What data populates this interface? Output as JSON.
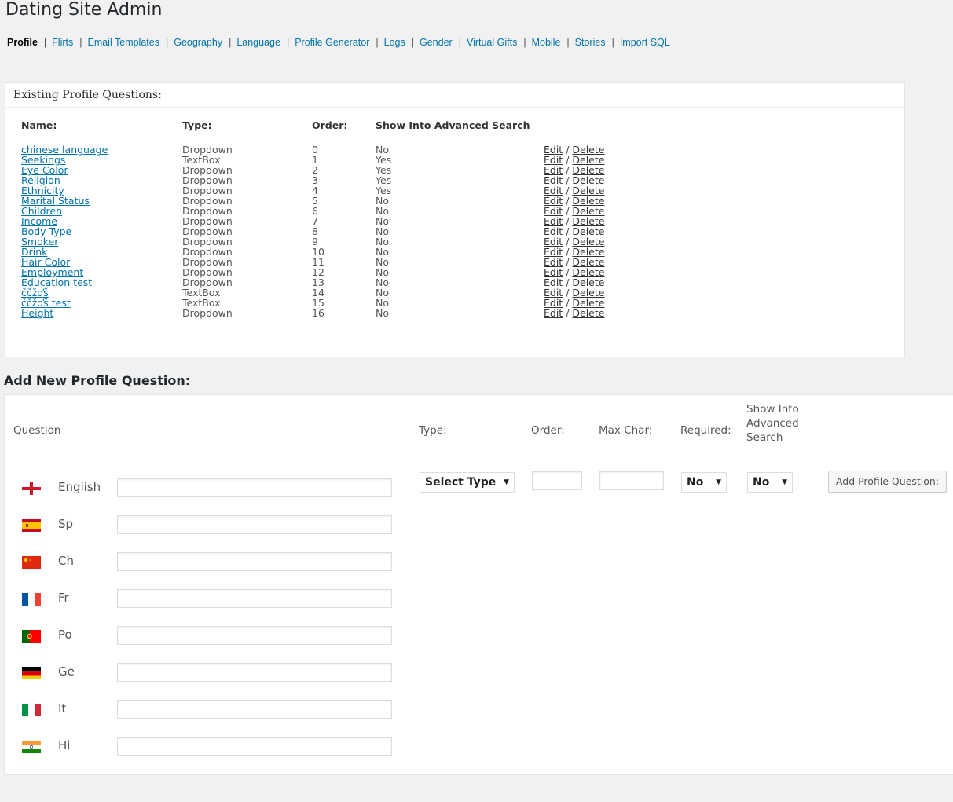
{
  "app_title": "Dating Site Admin",
  "nav": [
    {
      "label": "Profile",
      "current": true
    },
    {
      "label": "Flirts"
    },
    {
      "label": "Email Templates"
    },
    {
      "label": "Geography"
    },
    {
      "label": "Language"
    },
    {
      "label": "Profile Generator"
    },
    {
      "label": "Logs"
    },
    {
      "label": "Gender"
    },
    {
      "label": "Virtual Gifts"
    },
    {
      "label": "Mobile"
    },
    {
      "label": "Stories"
    },
    {
      "label": "Import SQL"
    }
  ],
  "existing": {
    "title": "Existing Profile Questions:",
    "headers": {
      "name": "Name:",
      "type": "Type:",
      "order": "Order:",
      "advanced": "Show Into Advanced Search"
    },
    "edit_label": "Edit",
    "delete_label": "Delete",
    "rows": [
      {
        "name": "chinese language",
        "type": "Dropdown",
        "order": "0",
        "advanced": "No"
      },
      {
        "name": "Seekings",
        "type": "TextBox",
        "order": "1",
        "advanced": "Yes"
      },
      {
        "name": "Eye Color",
        "type": "Dropdown",
        "order": "2",
        "advanced": "Yes"
      },
      {
        "name": "Religion",
        "type": "Dropdown",
        "order": "3",
        "advanced": "Yes"
      },
      {
        "name": "Ethnicity",
        "type": "Dropdown",
        "order": "4",
        "advanced": "Yes"
      },
      {
        "name": "Marital Status",
        "type": "Dropdown",
        "order": "5",
        "advanced": "No"
      },
      {
        "name": "Children",
        "type": "Dropdown",
        "order": "6",
        "advanced": "No"
      },
      {
        "name": "Income",
        "type": "Dropdown",
        "order": "7",
        "advanced": "No"
      },
      {
        "name": "Body Type",
        "type": "Dropdown",
        "order": "8",
        "advanced": "No"
      },
      {
        "name": "Smoker",
        "type": "Dropdown",
        "order": "9",
        "advanced": "No"
      },
      {
        "name": "Drink",
        "type": "Dropdown",
        "order": "10",
        "advanced": "No"
      },
      {
        "name": "Hair Color",
        "type": "Dropdown",
        "order": "11",
        "advanced": "No"
      },
      {
        "name": "Employment",
        "type": "Dropdown",
        "order": "12",
        "advanced": "No"
      },
      {
        "name": "Education test",
        "type": "Dropdown",
        "order": "13",
        "advanced": "No"
      },
      {
        "name": "ččžďš",
        "type": "TextBox",
        "order": "14",
        "advanced": "No"
      },
      {
        "name": "ččžďš test",
        "type": "TextBox",
        "order": "15",
        "advanced": "No"
      },
      {
        "name": "Height",
        "type": "Dropdown",
        "order": "16",
        "advanced": "No"
      }
    ]
  },
  "add_new": {
    "title": "Add New Profile Question:",
    "labels": {
      "question": "Question",
      "type": "Type:",
      "order": "Order:",
      "max_char": "Max Char:",
      "required": "Required:",
      "advanced": "Show Into Advanced Search"
    },
    "languages": [
      {
        "name": "English",
        "flag": "england"
      },
      {
        "name": "Sp",
        "flag": "spain"
      },
      {
        "name": "Ch",
        "flag": "china"
      },
      {
        "name": "Fr",
        "flag": "france"
      },
      {
        "name": "Po",
        "flag": "portugal"
      },
      {
        "name": "Ge",
        "flag": "germany"
      },
      {
        "name": "It",
        "flag": "italy"
      },
      {
        "name": "Hi",
        "flag": "india"
      }
    ],
    "type_select": "Select Type",
    "order_value": "",
    "max_char_value": "",
    "required_value": "No",
    "advanced_value": "No",
    "submit_label": "Add Profile Question:"
  },
  "colors": {
    "link": "#0073aa",
    "page_bg": "#f1f1f1",
    "panel_bg": "#ffffff"
  }
}
